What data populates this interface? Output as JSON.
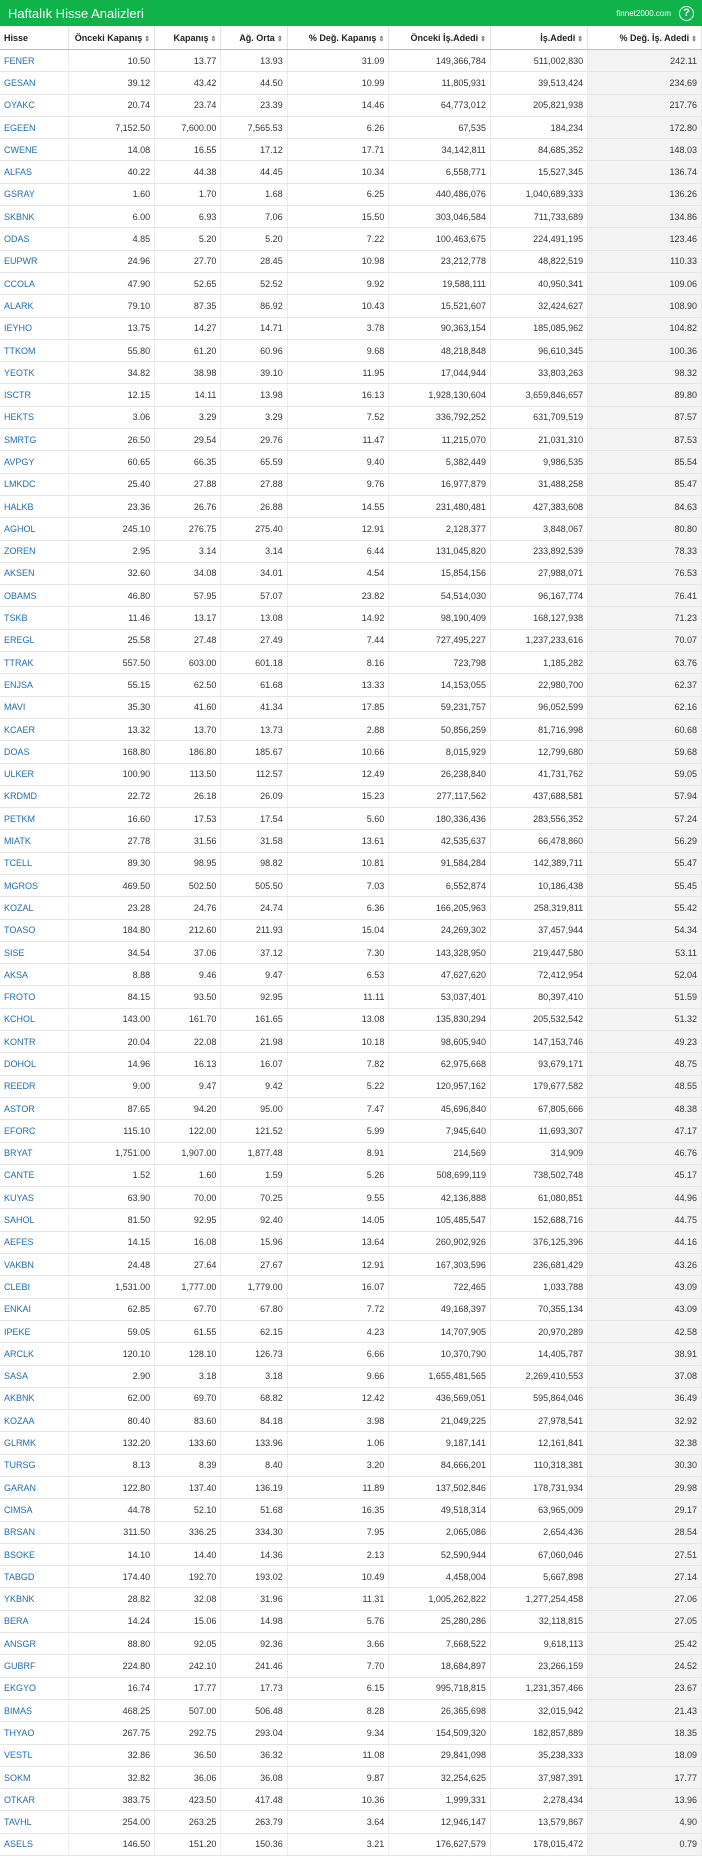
{
  "header": {
    "title": "Haftalık Hisse Analizleri",
    "brand": "finnet2000.com",
    "help": "?"
  },
  "columns": [
    {
      "label": "Hisse",
      "sortable": false
    },
    {
      "label": "Önceki Kapanış",
      "sortable": true
    },
    {
      "label": "Kapanış",
      "sortable": true
    },
    {
      "label": "Ağ. Orta",
      "sortable": true
    },
    {
      "label": "% Değ. Kapanış",
      "sortable": true
    },
    {
      "label": "Önceki İş.Adedi",
      "sortable": true
    },
    {
      "label": "İş.Adedi",
      "sortable": true
    },
    {
      "label": "% Değ. İş. Adedi",
      "sortable": true
    }
  ],
  "rows": [
    [
      "FENER",
      "10.50",
      "13.77",
      "13.93",
      "31.09",
      "149,366,784",
      "511,002,830",
      "242.11"
    ],
    [
      "GESAN",
      "39.12",
      "43.42",
      "44.50",
      "10.99",
      "11,805,931",
      "39,513,424",
      "234.69"
    ],
    [
      "OYAKC",
      "20.74",
      "23.74",
      "23.39",
      "14.46",
      "64,773,012",
      "205,821,938",
      "217.76"
    ],
    [
      "EGEEN",
      "7,152.50",
      "7,600.00",
      "7,565.53",
      "6.26",
      "67,535",
      "184,234",
      "172.80"
    ],
    [
      "CWENE",
      "14.08",
      "16.55",
      "17.12",
      "17.71",
      "34,142,811",
      "84,685,352",
      "148.03"
    ],
    [
      "ALFAS",
      "40.22",
      "44.38",
      "44.45",
      "10.34",
      "6,558,771",
      "15,527,345",
      "136.74"
    ],
    [
      "GSRAY",
      "1.60",
      "1.70",
      "1.68",
      "6.25",
      "440,486,076",
      "1,040,689,333",
      "136.26"
    ],
    [
      "SKBNK",
      "6.00",
      "6.93",
      "7.06",
      "15.50",
      "303,046,584",
      "711,733,689",
      "134.86"
    ],
    [
      "ODAS",
      "4.85",
      "5.20",
      "5.20",
      "7.22",
      "100,463,675",
      "224,491,195",
      "123.46"
    ],
    [
      "EUPWR",
      "24.96",
      "27.70",
      "28.45",
      "10.98",
      "23,212,778",
      "48,822,519",
      "110.33"
    ],
    [
      "CCOLA",
      "47.90",
      "52.65",
      "52.52",
      "9.92",
      "19,588,111",
      "40,950,341",
      "109.06"
    ],
    [
      "ALARK",
      "79.10",
      "87.35",
      "86.92",
      "10.43",
      "15,521,607",
      "32,424,627",
      "108.90"
    ],
    [
      "IEYHO",
      "13.75",
      "14.27",
      "14.71",
      "3.78",
      "90,363,154",
      "185,085,962",
      "104.82"
    ],
    [
      "TTKOM",
      "55.80",
      "61.20",
      "60.96",
      "9.68",
      "48,218,848",
      "96,610,345",
      "100.36"
    ],
    [
      "YEOTK",
      "34.82",
      "38.98",
      "39.10",
      "11.95",
      "17,044,944",
      "33,803,263",
      "98.32"
    ],
    [
      "ISCTR",
      "12.15",
      "14.11",
      "13.98",
      "16.13",
      "1,928,130,604",
      "3,659,846,657",
      "89.80"
    ],
    [
      "HEKTS",
      "3.06",
      "3.29",
      "3.29",
      "7.52",
      "336,792,252",
      "631,709,519",
      "87.57"
    ],
    [
      "SMRTG",
      "26.50",
      "29.54",
      "29.76",
      "11.47",
      "11,215,070",
      "21,031,310",
      "87.53"
    ],
    [
      "AVPGY",
      "60.65",
      "66.35",
      "65.59",
      "9.40",
      "5,382,449",
      "9,986,535",
      "85.54"
    ],
    [
      "LMKDC",
      "25.40",
      "27.88",
      "27.88",
      "9.76",
      "16,977,879",
      "31,488,258",
      "85.47"
    ],
    [
      "HALKB",
      "23.36",
      "26.76",
      "26.88",
      "14.55",
      "231,480,481",
      "427,383,608",
      "84.63"
    ],
    [
      "AGHOL",
      "245.10",
      "276.75",
      "275.40",
      "12.91",
      "2,128,377",
      "3,848,067",
      "80.80"
    ],
    [
      "ZOREN",
      "2.95",
      "3.14",
      "3.14",
      "6.44",
      "131,045,820",
      "233,892,539",
      "78.33"
    ],
    [
      "AKSEN",
      "32.60",
      "34.08",
      "34.01",
      "4.54",
      "15,854,156",
      "27,988,071",
      "76.53"
    ],
    [
      "OBAMS",
      "46.80",
      "57.95",
      "57.07",
      "23.82",
      "54,514,030",
      "96,167,774",
      "76.41"
    ],
    [
      "TSKB",
      "11.46",
      "13.17",
      "13.08",
      "14.92",
      "98,190,409",
      "168,127,938",
      "71.23"
    ],
    [
      "EREGL",
      "25.58",
      "27.48",
      "27.49",
      "7.44",
      "727,495,227",
      "1,237,233,616",
      "70.07"
    ],
    [
      "TTRAK",
      "557.50",
      "603.00",
      "601.18",
      "8.16",
      "723,798",
      "1,185,282",
      "63.76"
    ],
    [
      "ENJSA",
      "55.15",
      "62.50",
      "61.68",
      "13.33",
      "14,153,055",
      "22,980,700",
      "62.37"
    ],
    [
      "MAVI",
      "35.30",
      "41.60",
      "41.34",
      "17.85",
      "59,231,757",
      "96,052,599",
      "62.16"
    ],
    [
      "KCAER",
      "13.32",
      "13.70",
      "13.73",
      "2.88",
      "50,856,259",
      "81,716,998",
      "60.68"
    ],
    [
      "DOAS",
      "168.80",
      "186.80",
      "185.67",
      "10.66",
      "8,015,929",
      "12,799,680",
      "59.68"
    ],
    [
      "ULKER",
      "100.90",
      "113.50",
      "112.57",
      "12.49",
      "26,238,840",
      "41,731,762",
      "59.05"
    ],
    [
      "KRDMD",
      "22.72",
      "26.18",
      "26.09",
      "15.23",
      "277,117,562",
      "437,688,581",
      "57.94"
    ],
    [
      "PETKM",
      "16.60",
      "17.53",
      "17.54",
      "5.60",
      "180,336,436",
      "283,556,352",
      "57.24"
    ],
    [
      "MIATK",
      "27.78",
      "31.56",
      "31.58",
      "13.61",
      "42,535,637",
      "66,478,860",
      "56.29"
    ],
    [
      "TCELL",
      "89.30",
      "98.95",
      "98.82",
      "10.81",
      "91,584,284",
      "142,389,711",
      "55.47"
    ],
    [
      "MGROS",
      "469.50",
      "502.50",
      "505.50",
      "7.03",
      "6,552,874",
      "10,186,438",
      "55.45"
    ],
    [
      "KOZAL",
      "23.28",
      "24.76",
      "24.74",
      "6.36",
      "166,205,963",
      "258,319,811",
      "55.42"
    ],
    [
      "TOASO",
      "184.80",
      "212.60",
      "211.93",
      "15.04",
      "24,269,302",
      "37,457,944",
      "54.34"
    ],
    [
      "SISE",
      "34.54",
      "37.06",
      "37.12",
      "7.30",
      "143,328,950",
      "219,447,580",
      "53.11"
    ],
    [
      "AKSA",
      "8.88",
      "9.46",
      "9.47",
      "6.53",
      "47,627,620",
      "72,412,954",
      "52.04"
    ],
    [
      "FROTO",
      "84.15",
      "93.50",
      "92.95",
      "11.11",
      "53,037,401",
      "80,397,410",
      "51.59"
    ],
    [
      "KCHOL",
      "143.00",
      "161.70",
      "161.65",
      "13.08",
      "135,830,294",
      "205,532,542",
      "51.32"
    ],
    [
      "KONTR",
      "20.04",
      "22.08",
      "21.98",
      "10.18",
      "98,605,940",
      "147,153,746",
      "49.23"
    ],
    [
      "DOHOL",
      "14.96",
      "16.13",
      "16.07",
      "7.82",
      "62,975,668",
      "93,679,171",
      "48.75"
    ],
    [
      "REEDR",
      "9.00",
      "9.47",
      "9.42",
      "5.22",
      "120,957,162",
      "179,677,582",
      "48.55"
    ],
    [
      "ASTOR",
      "87.65",
      "94.20",
      "95.00",
      "7.47",
      "45,696,840",
      "67,805,666",
      "48.38"
    ],
    [
      "EFORC",
      "115.10",
      "122.00",
      "121.52",
      "5.99",
      "7,945,640",
      "11,693,307",
      "47.17"
    ],
    [
      "BRYAT",
      "1,751.00",
      "1,907.00",
      "1,877.48",
      "8.91",
      "214,569",
      "314,909",
      "46.76"
    ],
    [
      "CANTE",
      "1.52",
      "1.60",
      "1.59",
      "5.26",
      "508,699,119",
      "738,502,748",
      "45.17"
    ],
    [
      "KUYAS",
      "63.90",
      "70.00",
      "70.25",
      "9.55",
      "42,136,888",
      "61,080,851",
      "44.96"
    ],
    [
      "SAHOL",
      "81.50",
      "92.95",
      "92.40",
      "14.05",
      "105,485,547",
      "152,688,716",
      "44.75"
    ],
    [
      "AEFES",
      "14.15",
      "16.08",
      "15.96",
      "13.64",
      "260,902,926",
      "376,125,396",
      "44.16"
    ],
    [
      "VAKBN",
      "24.48",
      "27.64",
      "27.67",
      "12.91",
      "167,303,596",
      "236,681,429",
      "43.26"
    ],
    [
      "CLEBI",
      "1,531.00",
      "1,777.00",
      "1,779.00",
      "16.07",
      "722,465",
      "1,033,788",
      "43.09"
    ],
    [
      "ENKAI",
      "62.85",
      "67.70",
      "67.80",
      "7.72",
      "49,168,397",
      "70,355,134",
      "43.09"
    ],
    [
      "IPEKE",
      "59.05",
      "61.55",
      "62.15",
      "4.23",
      "14,707,905",
      "20,970,289",
      "42.58"
    ],
    [
      "ARCLK",
      "120.10",
      "128.10",
      "126.73",
      "6.66",
      "10,370,790",
      "14,405,787",
      "38.91"
    ],
    [
      "SASA",
      "2.90",
      "3.18",
      "3.18",
      "9.66",
      "1,655,481,565",
      "2,269,410,553",
      "37.08"
    ],
    [
      "AKBNK",
      "62.00",
      "69.70",
      "68.82",
      "12.42",
      "436,569,051",
      "595,864,046",
      "36.49"
    ],
    [
      "KOZAA",
      "80.40",
      "83.60",
      "84.18",
      "3.98",
      "21,049,225",
      "27,978,541",
      "32.92"
    ],
    [
      "GLRMK",
      "132.20",
      "133.60",
      "133.96",
      "1.06",
      "9,187,141",
      "12,161,841",
      "32.38"
    ],
    [
      "TURSG",
      "8.13",
      "8.39",
      "8.40",
      "3.20",
      "84,666,201",
      "110,318,381",
      "30.30"
    ],
    [
      "GARAN",
      "122.80",
      "137.40",
      "136.19",
      "11.89",
      "137,502,846",
      "178,731,934",
      "29.98"
    ],
    [
      "CIMSA",
      "44.78",
      "52.10",
      "51.68",
      "16.35",
      "49,518,314",
      "63,965,009",
      "29.17"
    ],
    [
      "BRSAN",
      "311.50",
      "336.25",
      "334.30",
      "7.95",
      "2,065,086",
      "2,654,436",
      "28.54"
    ],
    [
      "BSOKE",
      "14.10",
      "14.40",
      "14.36",
      "2.13",
      "52,590,944",
      "67,060,046",
      "27.51"
    ],
    [
      "TABGD",
      "174.40",
      "192.70",
      "193.02",
      "10.49",
      "4,458,004",
      "5,667,898",
      "27.14"
    ],
    [
      "YKBNK",
      "28.82",
      "32.08",
      "31.96",
      "11.31",
      "1,005,262,822",
      "1,277,254,458",
      "27.06"
    ],
    [
      "BERA",
      "14.24",
      "15.06",
      "14.98",
      "5.76",
      "25,280,286",
      "32,118,815",
      "27.05"
    ],
    [
      "ANSGR",
      "88.80",
      "92.05",
      "92.36",
      "3.66",
      "7,668,522",
      "9,618,113",
      "25.42"
    ],
    [
      "GUBRF",
      "224.80",
      "242.10",
      "241.46",
      "7.70",
      "18,684,897",
      "23,266,159",
      "24.52"
    ],
    [
      "EKGYO",
      "16.74",
      "17.77",
      "17.73",
      "6.15",
      "995,718,815",
      "1,231,357,466",
      "23.67"
    ],
    [
      "BIMAS",
      "468.25",
      "507.00",
      "506.48",
      "8.28",
      "26,365,698",
      "32,015,942",
      "21.43"
    ],
    [
      "THYAO",
      "267.75",
      "292.75",
      "293.04",
      "9.34",
      "154,509,320",
      "182,857,889",
      "18.35"
    ],
    [
      "VESTL",
      "32.86",
      "36.50",
      "36.32",
      "11.08",
      "29,841,098",
      "35,238,333",
      "18.09"
    ],
    [
      "SOKM",
      "32.82",
      "36.06",
      "36.08",
      "9.87",
      "32,254,625",
      "37,987,391",
      "17.77"
    ],
    [
      "OTKAR",
      "383.75",
      "423.50",
      "417.48",
      "10.36",
      "1,999,331",
      "2,278,434",
      "13.96"
    ],
    [
      "TAVHL",
      "254.00",
      "263.25",
      "263.79",
      "3.64",
      "12,946,147",
      "13,579,867",
      "4.90"
    ],
    [
      "ASELS",
      "146.50",
      "151.20",
      "150.36",
      "3.21",
      "176,627,579",
      "178,015,472",
      "0.79"
    ]
  ]
}
